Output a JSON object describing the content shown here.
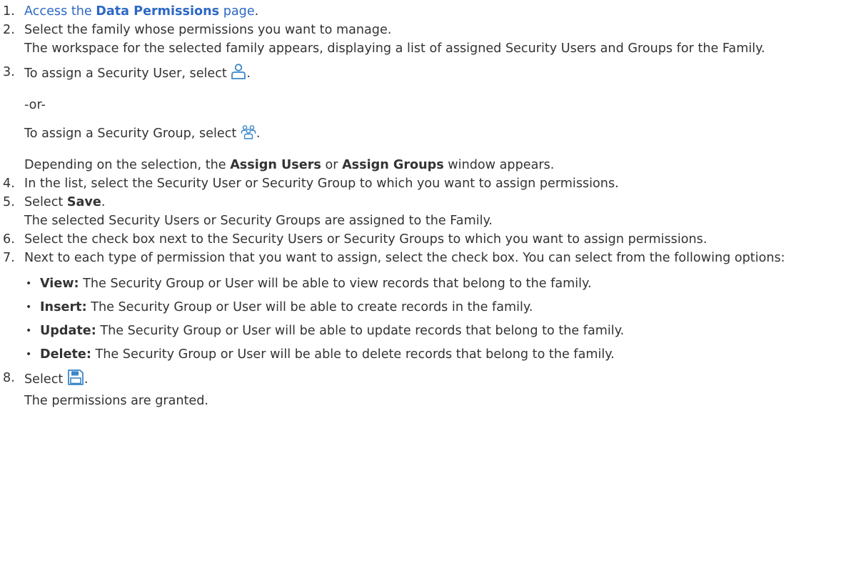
{
  "steps": [
    {
      "num": "1.",
      "link": "Access the ",
      "bold": "Data Permissions",
      "after": " page",
      "end": "."
    },
    {
      "num": "2.",
      "text": "Select the family whose permissions you want to manage.",
      "sub": "The workspace for the selected family appears, displaying a list of assigned Security Users and Groups for the Family."
    },
    {
      "num": "3.",
      "a": "To assign a Security User, select ",
      "or": "-or-",
      "b": "To assign a Security Group, select ",
      "c1": "Depending on the selection, the ",
      "c2": "Assign Users",
      "c3": " or ",
      "c4": "Assign Groups",
      "c5": " window appears."
    },
    {
      "num": "4.",
      "text": "In the list, select the Security User or Security Group to which you want to assign permissions."
    },
    {
      "num": "5.",
      "pre": "Select ",
      "bold": "Save",
      "post": ".",
      "sub": "The selected Security Users or Security Groups are assigned to the Family."
    },
    {
      "num": "6.",
      "text": "Select the check box next to the Security Users or Security Groups to which you want to assign permissions."
    },
    {
      "num": "7.",
      "text": "Next to each type of permission that you want to assign, select the check box. You can select from the following options:",
      "bullets": [
        {
          "label": "View:",
          "text": " The Security Group or User will be able to view records that belong to the family."
        },
        {
          "label": "Insert:",
          "text": " The Security Group or User will be able to create records in the family."
        },
        {
          "label": "Update:",
          "text": " The Security Group or User will be able to update records that belong to the family."
        },
        {
          "label": "Delete:",
          "text": " The Security Group or User will be able to delete records that belong to the family."
        }
      ]
    },
    {
      "num": "8.",
      "pre": "Select ",
      "post": ".",
      "sub": "The permissions are granted."
    }
  ],
  "icons": {
    "user": "user-icon",
    "group": "group-icon",
    "save": "save-icon",
    "accent": "#3a86c8"
  },
  "colors": {
    "link": "#2d68c4",
    "text": "#333333"
  }
}
